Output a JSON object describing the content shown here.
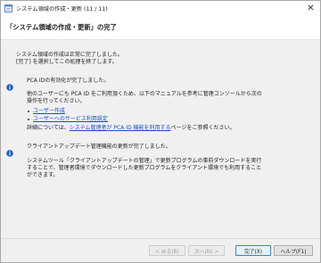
{
  "window": {
    "title": "システム領域の作成・更新 (11 / 11)",
    "close_glyph": "✕"
  },
  "header": {
    "heading": "「システム領域の作成・更新」の完了"
  },
  "main": {
    "intro_line1": "システム領域の作成は正常に完了しました。",
    "intro_line2": "[完了] を選択してこの処理を終了します。",
    "pca_section": {
      "title": "PCA IDの有効化が完了しました。",
      "body_line1": "他のユーザーにも PCA ID をご利用頂くため、以下のマニュアルを参考に管理コンソールから次の",
      "body_line2": "操作を行ってください。",
      "link1": "ユーザー作成",
      "link2": "ユーザーへのサービス利用設定",
      "detail_prefix": "詳細については、",
      "detail_link": "システム管理者が PCA ID 機能を利用する",
      "detail_suffix": "ページをご参照ください。"
    },
    "update_section": {
      "title": "クライアントアップデート管理機能の更新が完了しました。",
      "body_line1": "システムツール「クライアントアップデートの管理」で更新プログラムの事前ダウンロードを実行",
      "body_line2": "することで、管理者環境でダウンロードした更新プログラムをクライアント環境でも利用すること",
      "body_line3": "ができます。"
    }
  },
  "buttons": {
    "back": "< 戻る(B)",
    "next": "次へ(N) >",
    "finish": "完了(X)",
    "help": "ヘルプ(F1)"
  },
  "icons": {
    "app": "app-window-icon",
    "info": "info-icon",
    "close": "close-icon"
  },
  "colors": {
    "link": "#1a4ec9",
    "info_icon": "#1f5fc8"
  }
}
